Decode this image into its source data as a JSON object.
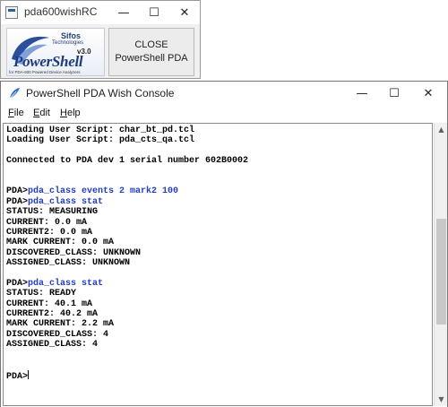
{
  "launcher": {
    "title": "pda600wishRC",
    "controls": {
      "minimize": "—",
      "maximize": "☐",
      "close": "✕"
    },
    "logo": {
      "brand": "Sifos",
      "tagline": "Technologies",
      "version": "v3.0",
      "product": "PowerShell",
      "subtitle": "for PDA-600 Powered Device Analyzers"
    },
    "close_button": {
      "line1": "CLOSE",
      "line2": "PowerShell PDA"
    }
  },
  "console_window": {
    "title": "PowerShell PDA Wish Console",
    "controls": {
      "minimize": "—",
      "maximize": "☐",
      "close": "✕"
    },
    "menu": [
      "File",
      "Edit",
      "Help"
    ],
    "lines": [
      {
        "prompt": "",
        "cmd": "",
        "text": "Loading User Script: char_bt_pd.tcl"
      },
      {
        "prompt": "",
        "cmd": "",
        "text": "Loading User Script: pda_cts_qa.tcl"
      },
      {
        "prompt": "",
        "cmd": "",
        "text": ""
      },
      {
        "prompt": "",
        "cmd": "",
        "text": "Connected to PDA dev 1 serial number 602B0002"
      },
      {
        "prompt": "",
        "cmd": "",
        "text": ""
      },
      {
        "prompt": "",
        "cmd": "",
        "text": ""
      },
      {
        "prompt": "PDA>",
        "cmd": "pda_class events 2 mark2 100",
        "text": ""
      },
      {
        "prompt": "PDA>",
        "cmd": "pda_class stat",
        "text": ""
      },
      {
        "prompt": "",
        "cmd": "",
        "text": "STATUS: MEASURING"
      },
      {
        "prompt": "",
        "cmd": "",
        "text": "CURRENT: 0.0 mA"
      },
      {
        "prompt": "",
        "cmd": "",
        "text": "CURRENT2: 0.0 mA"
      },
      {
        "prompt": "",
        "cmd": "",
        "text": "MARK CURRENT: 0.0 mA"
      },
      {
        "prompt": "",
        "cmd": "",
        "text": "DISCOVERED_CLASS: UNKNOWN"
      },
      {
        "prompt": "",
        "cmd": "",
        "text": "ASSIGNED_CLASS: UNKNOWN"
      },
      {
        "prompt": "",
        "cmd": "",
        "text": ""
      },
      {
        "prompt": "PDA>",
        "cmd": "pda_class stat",
        "text": ""
      },
      {
        "prompt": "",
        "cmd": "",
        "text": "STATUS: READY"
      },
      {
        "prompt": "",
        "cmd": "",
        "text": "CURRENT: 40.1 mA"
      },
      {
        "prompt": "",
        "cmd": "",
        "text": "CURRENT2: 40.2 mA"
      },
      {
        "prompt": "",
        "cmd": "",
        "text": "MARK CURRENT: 2.2 mA"
      },
      {
        "prompt": "",
        "cmd": "",
        "text": "DISCOVERED_CLASS: 4"
      },
      {
        "prompt": "",
        "cmd": "",
        "text": "ASSIGNED_CLASS: 4"
      },
      {
        "prompt": "",
        "cmd": "",
        "text": ""
      },
      {
        "prompt": "",
        "cmd": "",
        "text": ""
      },
      {
        "prompt": "PDA>",
        "cmd": "",
        "text": "",
        "cursor": true
      }
    ],
    "scrollbar": {
      "up_arrow": "▲",
      "down_arrow": "▼",
      "position": 0.55,
      "visible_fraction": 0.42
    }
  },
  "colors": {
    "command": "#1f3dd6",
    "text": "#000000",
    "logo_blue": "#1d3c83"
  }
}
